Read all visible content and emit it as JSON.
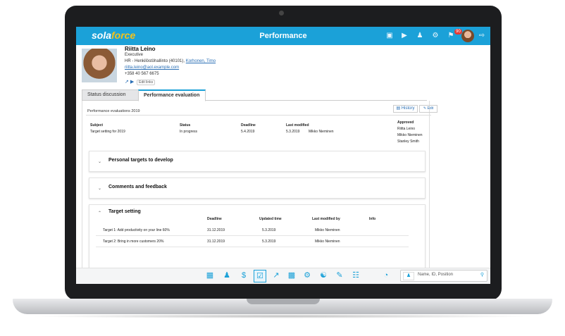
{
  "app": {
    "logo_prefix": "sola",
    "logo_suffix": "force",
    "title": "Performance",
    "notifications_count": "90",
    "accent_color": "#1ba1d8"
  },
  "top_icons": [
    "chat-icon",
    "video-icon",
    "user-add-icon",
    "gear-icon",
    "bell-icon",
    "avatar",
    "logout-icon"
  ],
  "profile": {
    "name": "Riitta Leino",
    "role": "Executive",
    "org_prefix": "HR - Henkilöstöhallinto (40101),",
    "manager": "Korhonen, Timo",
    "email": "riitta.leino@aol.example.com",
    "phone": "+358 40 567 6675",
    "edit_links_label": "Edit links"
  },
  "tabs": [
    {
      "label": "Status discussion",
      "active": false
    },
    {
      "label": "Performance evaluation",
      "active": true
    }
  ],
  "evaluations": {
    "title": "Performance evaluations 2019",
    "history_label": "History",
    "edit_label": "Edit",
    "headers": {
      "subject": "Subject",
      "status": "Status",
      "deadline": "Deadline",
      "last_modified": "Last modified",
      "approved": "Approved"
    },
    "row": {
      "subject": "Target setting for 2019",
      "status": "In progress",
      "deadline": "5.4.2019",
      "modified_date": "5.3.2019",
      "modified_by": "Mikko Nieminen",
      "approved": [
        "Riitta Leino",
        "Mikko Nieminen",
        "Stanley Smith"
      ]
    }
  },
  "sections": {
    "personal_targets": "Personal targets to develop",
    "comments": "Comments and feedback",
    "target_setting": "Target setting"
  },
  "target_table": {
    "headers": {
      "deadline": "Deadline",
      "updated": "Updated time",
      "modified_by": "Last modified by",
      "info": "Info"
    },
    "rows": [
      {
        "target": "Target 1: Add productivity on your line 60%",
        "deadline": "31.12.2019",
        "updated": "5.3.2019",
        "modified_by": "Mikko Nieminen"
      },
      {
        "target": "Target 2: Bring in more customers 20%",
        "deadline": "31.12.2019",
        "updated": "5.3.2019",
        "modified_by": "Mikko Nieminen"
      }
    ]
  },
  "bottom_nav": [
    "grid-icon",
    "person-icon",
    "dollar-icon",
    "checkbox-icon",
    "line-chart-icon",
    "bar-chart-icon",
    "gears-icon",
    "org-chart-icon",
    "edit-icon",
    "calendar-icon",
    "dashboard-icon"
  ],
  "search": {
    "placeholder": "Name, ID, Position"
  }
}
